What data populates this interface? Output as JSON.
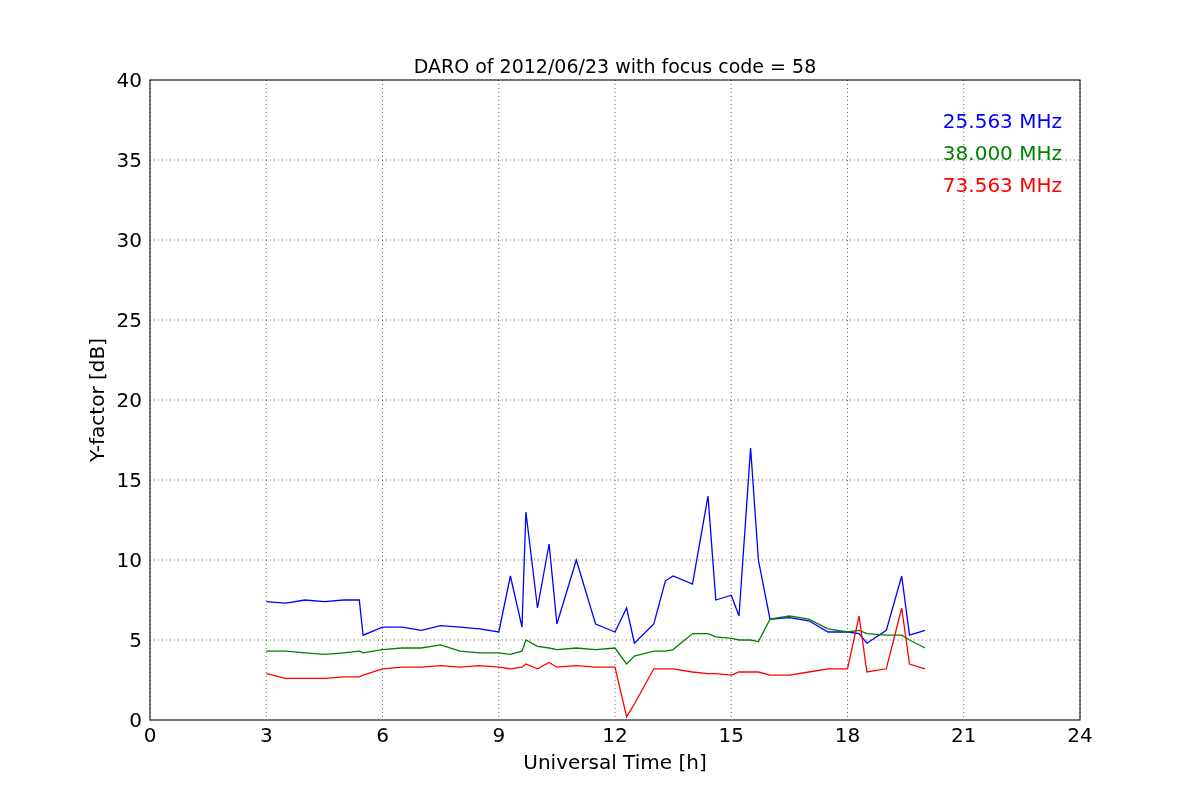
{
  "chart_data": {
    "type": "line",
    "title": "DARO of 2012/06/23 with focus code = 58",
    "xlabel": "Universal Time [h]",
    "ylabel": "Y-factor [dB]",
    "x": [
      3,
      3.5,
      4,
      4.5,
      5,
      5.4,
      5.5,
      6,
      6.5,
      7,
      7.5,
      8,
      8.5,
      9,
      9.3,
      9.6,
      9.7,
      10,
      10.3,
      10.5,
      11,
      11.5,
      12,
      12.3,
      12.5,
      13,
      13.3,
      13.5,
      14,
      14.4,
      14.6,
      15,
      15.2,
      15.5,
      15.7,
      16,
      16.5,
      17,
      17.5,
      18,
      18.3,
      18.5,
      19,
      19.4,
      19.6,
      20
    ],
    "series": [
      {
        "name": "25.563 MHz",
        "color": "#0000ff",
        "values": [
          7.4,
          7.3,
          7.5,
          7.4,
          7.5,
          7.5,
          5.3,
          5.8,
          5.8,
          5.6,
          5.9,
          5.8,
          5.7,
          5.5,
          9,
          5.8,
          13,
          7,
          11,
          6,
          10,
          6,
          5.5,
          7,
          4.8,
          6,
          8.7,
          9,
          8.5,
          14,
          7.5,
          7.8,
          6.5,
          17,
          10,
          6.3,
          6.4,
          6.2,
          5.5,
          5.5,
          5.4,
          4.8,
          5.6,
          9,
          5.3,
          5.6
        ]
      },
      {
        "name": "38.000 MHz",
        "color": "#008000",
        "values": [
          4.3,
          4.3,
          4.2,
          4.1,
          4.2,
          4.3,
          4.2,
          4.4,
          4.5,
          4.5,
          4.7,
          4.3,
          4.2,
          4.2,
          4.1,
          4.3,
          5,
          4.6,
          4.5,
          4.4,
          4.5,
          4.4,
          4.5,
          3.5,
          4,
          4.3,
          4.3,
          4.4,
          5.4,
          5.4,
          5.2,
          5.1,
          5,
          5,
          4.9,
          6.3,
          6.5,
          6.3,
          5.7,
          5.5,
          5.6,
          5.4,
          5.3,
          5.3,
          5,
          4.5
        ]
      },
      {
        "name": "73.563 MHz",
        "color": "#ff0000",
        "values": [
          2.9,
          2.6,
          2.6,
          2.6,
          2.7,
          2.7,
          2.8,
          3.2,
          3.3,
          3.3,
          3.4,
          3.3,
          3.4,
          3.3,
          3.2,
          3.3,
          3.5,
          3.2,
          3.6,
          3.3,
          3.4,
          3.3,
          3.3,
          0.2,
          1,
          3.2,
          3.2,
          3.2,
          3.0,
          2.9,
          2.9,
          2.8,
          3.0,
          3.0,
          3.0,
          2.8,
          2.8,
          3.0,
          3.2,
          3.2,
          6.5,
          3,
          3.2,
          7,
          3.5,
          3.2
        ]
      }
    ],
    "xlim": [
      0,
      24
    ],
    "ylim": [
      0,
      40
    ],
    "xticks": [
      0,
      3,
      6,
      9,
      12,
      15,
      18,
      21,
      24
    ],
    "yticks": [
      0,
      5,
      10,
      15,
      20,
      25,
      30,
      35,
      40
    ],
    "grid": true
  }
}
